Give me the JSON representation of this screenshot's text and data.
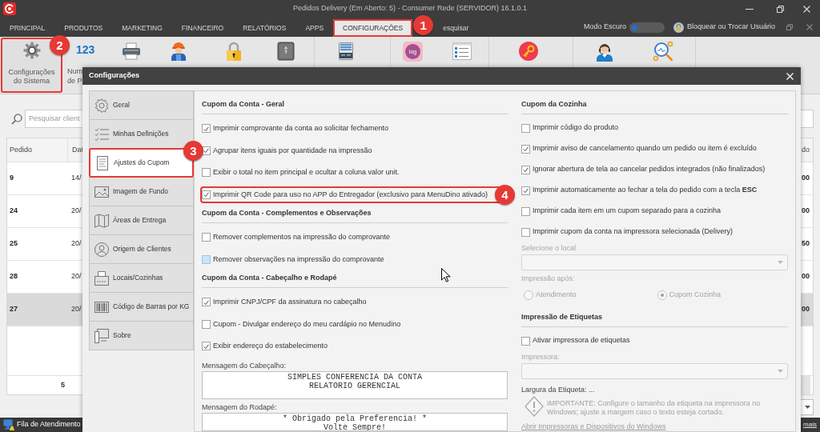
{
  "window": {
    "title": "Pedidos Delivery (Em Aberto: 5) - Consumer Rede (SERVIDOR) 16.1.0.1"
  },
  "menu": [
    {
      "label": "PRINCIPAL",
      "selected": false
    },
    {
      "label": "PRODUTOS",
      "selected": false
    },
    {
      "label": "MARKETING",
      "selected": false
    },
    {
      "label": "FINANCEIRO",
      "selected": false
    },
    {
      "label": "RELATÓRIOS",
      "selected": false
    },
    {
      "label": "APPS",
      "selected": false
    },
    {
      "label": "CONFIGURAÇÕES",
      "selected": true,
      "callout": "1"
    },
    {
      "label": "esquisar",
      "selected": false
    }
  ],
  "dark_mode": {
    "label": "Modo Escuro",
    "on": false
  },
  "user_button": {
    "label": "Bloquear ou Trocar Usuário"
  },
  "toolbar": [
    {
      "label_lines": [
        "Configurações",
        "do Sistema"
      ],
      "callout": "2"
    },
    {
      "icon_text": "123",
      "label_lines": [
        "Num",
        "de P"
      ]
    },
    {
      "icon_text": "log"
    }
  ],
  "main": {
    "search": {
      "placeholder": "Pesquisar client"
    },
    "table": {
      "columns": [
        "Pedido",
        "Dat",
        "do"
      ],
      "rows": [
        {
          "cells": [
            "9",
            "14/",
            "00"
          ],
          "selected": false
        },
        {
          "cells": [
            "24",
            "20/",
            "00"
          ],
          "selected": false
        },
        {
          "cells": [
            "25",
            "20/",
            "50"
          ],
          "selected": false
        },
        {
          "cells": [
            "28",
            "20/",
            "00"
          ],
          "selected": false
        },
        {
          "cells": [
            "27",
            "20/",
            "00"
          ],
          "selected": true
        }
      ],
      "footer": "5"
    }
  },
  "status_bar": {
    "queue": "Fila de Atendimento",
    "link": "mais"
  },
  "dialog": {
    "title": "Configurações",
    "nav": [
      {
        "label": "Geral",
        "selected": false
      },
      {
        "label": "Minhas Definições",
        "selected": false
      },
      {
        "label": "Ajustes do Cupom",
        "selected": true,
        "callout": "3"
      },
      {
        "label": "Imagem de Fundo",
        "selected": false
      },
      {
        "label": "Áreas de Entrega",
        "selected": false
      },
      {
        "label": "Origem de Clientes",
        "selected": false
      },
      {
        "label": "Locais/Cozinhas",
        "selected": false
      },
      {
        "label": "Código de Barras por KG",
        "selected": false
      },
      {
        "label": "Sobre",
        "selected": false
      }
    ],
    "left_column": [
      {
        "kind": "heading",
        "text": "Cupom da Conta - Geral"
      },
      {
        "kind": "checkbox",
        "label": "Imprimir comprovante da conta ao solicitar fechamento",
        "checked": true
      },
      {
        "kind": "checkbox",
        "label": "Agrupar itens iguais por quantidade na impressão",
        "checked": true
      },
      {
        "kind": "checkbox",
        "label": "Exibir o total no item principal e ocultar a coluna valor unit.",
        "checked": false
      },
      {
        "kind": "checkbox",
        "label": "Imprimir QR Code para uso no APP do Entregador (exclusivo para MenuDino ativado)",
        "checked": true,
        "callout": "4"
      },
      {
        "kind": "heading",
        "text": "Cupom da Conta - Complementos e Observações"
      },
      {
        "kind": "checkbox",
        "label": "Remover complementos na impressão do comprovante",
        "checked": false
      },
      {
        "kind": "checkbox",
        "label": "Remover observações na impressão do comprovante",
        "checked": false,
        "hovered": true
      },
      {
        "kind": "heading",
        "text": "Cupom da Conta - Cabeçalho e Rodapé"
      },
      {
        "kind": "checkbox",
        "label": "Imprimir CNPJ/CPF da assinatura no cabeçalho",
        "checked": true
      },
      {
        "kind": "checkbox",
        "label": "Cupom - Divulgar endereço do meu cardápio no Menudino",
        "checked": false
      },
      {
        "kind": "checkbox",
        "label": "Exibir endereço do estabelecimento",
        "checked": true
      },
      {
        "kind": "message",
        "label": "Mensagem do Cabeçalho:",
        "value": "SIMPLES CONFERENCIA DA CONTA\nRELATORIO GERENCIAL"
      },
      {
        "kind": "message",
        "label": "Mensagem do Rodapé:",
        "value": "* Obrigado pela Preferencia! *\nVolte Sempre!"
      }
    ],
    "right_column": [
      {
        "kind": "heading",
        "text": "Cupom da Cozinha"
      },
      {
        "kind": "checkbox",
        "label": "Imprimir código do produto",
        "checked": false
      },
      {
        "kind": "checkbox",
        "label": "Imprimir aviso de cancelamento quando um pedido ou item é excluído",
        "checked": true
      },
      {
        "kind": "checkbox",
        "label": "Ignorar abertura de tela ao cancelar pedidos integrados (não finalizados)",
        "checked": true
      },
      {
        "kind": "checkbox",
        "label": "Imprimir automaticamente ao fechar a tela do pedido com a tecla **ESC**",
        "checked": true
      },
      {
        "kind": "checkbox",
        "label": "Imprimir cada item em um cupom separado para a cozinha",
        "checked": false
      },
      {
        "kind": "checkbox",
        "label": "Imprimir cupom da conta na impressora selecionada (Delivery)",
        "checked": false
      },
      {
        "kind": "dropdown",
        "label": "Selecione o local",
        "disabled": true
      },
      {
        "kind": "radios",
        "label": "Impressão após:",
        "disabled": true,
        "options": [
          {
            "label": "Atendimento",
            "selected": false
          },
          {
            "label": "Cupom Cozinha",
            "selected": true
          }
        ]
      },
      {
        "kind": "heading",
        "text": "Impressão de Etiquetas"
      },
      {
        "kind": "checkbox",
        "label": "Ativar impressora de etiquetas",
        "checked": false
      },
      {
        "kind": "dropdown",
        "label": "Impressora:",
        "disabled": true
      },
      {
        "kind": "text",
        "text": "Largura da Etiqueta: ..."
      },
      {
        "kind": "note",
        "text": "IMPORTANTE: Configure o tamanho da etiqueta na impressora no Windows; ajuste a margem caso o texto esteja cortado."
      },
      {
        "kind": "link",
        "text": "Abrir Impressoras e Dispositivos do Windows"
      }
    ]
  }
}
